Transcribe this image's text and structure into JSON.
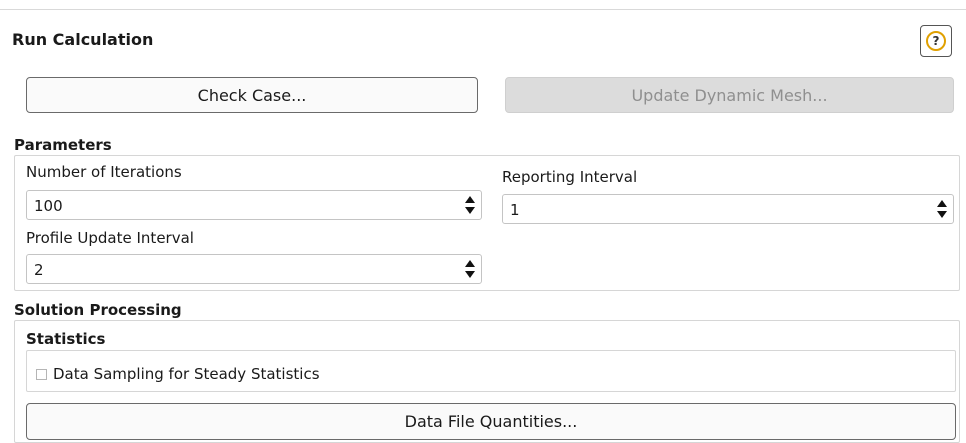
{
  "panel": {
    "title": "Run Calculation",
    "help_symbol": "?"
  },
  "actions": {
    "check_case": "Check Case...",
    "update_dynamic_mesh": "Update Dynamic Mesh..."
  },
  "parameters": {
    "heading": "Parameters",
    "iterations": {
      "label": "Number of Iterations",
      "value": "100"
    },
    "reporting": {
      "label": "Reporting Interval",
      "value": "1"
    },
    "profile_update": {
      "label": "Profile Update Interval",
      "value": "2"
    }
  },
  "solution_processing": {
    "heading": "Solution Processing",
    "statistics": {
      "heading": "Statistics",
      "data_sampling_label": "Data Sampling for Steady Statistics",
      "data_sampling_checked": false
    },
    "data_file_quantities": "Data File Quantities..."
  },
  "icons": {
    "help": "help-icon",
    "spinner": "spinner-arrows-icon"
  },
  "colors": {
    "help_ring": "#e0a000",
    "disabled_button_bg": "#dcdcdc",
    "disabled_button_text": "#8f8f8f"
  }
}
